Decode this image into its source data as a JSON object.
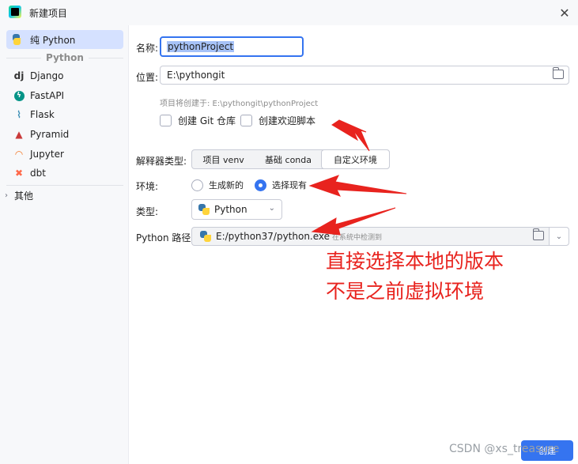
{
  "window": {
    "title": "新建项目"
  },
  "sidebar": {
    "items": [
      {
        "label": "纯 Python",
        "icon": "python-icon"
      },
      {
        "label": "Django",
        "icon": "django-icon"
      },
      {
        "label": "FastAPI",
        "icon": "fastapi-icon"
      },
      {
        "label": "Flask",
        "icon": "flask-icon"
      },
      {
        "label": "Pyramid",
        "icon": "pyramid-icon"
      },
      {
        "label": "Jupyter",
        "icon": "jupyter-icon"
      },
      {
        "label": "dbt",
        "icon": "dbt-icon"
      }
    ],
    "group_label": "Python",
    "other_label": "其他"
  },
  "form": {
    "name_label": "名称:",
    "name_value": "pythonProject",
    "location_label": "位置:",
    "location_value": "E:\\pythongit",
    "location_hint": "项目将创建于: E:\\pythongit\\pythonProject",
    "git_checkbox": "创建 Git 仓库",
    "welcome_checkbox": "创建欢迎脚本",
    "interpreter_label": "解释器类型:",
    "interpreter_tabs": [
      "项目 venv",
      "基础 conda",
      "自定义环境"
    ],
    "env_label": "环境:",
    "env_option_new": "生成新的",
    "env_option_existing": "选择现有",
    "type_label": "类型:",
    "type_value": "Python",
    "path_label": "Python 路径:",
    "path_value": "E:/python37/python.exe",
    "path_detected": "在系统中检测到",
    "create_button": "创建"
  },
  "annotation": {
    "line1": "直接选择本地的版本",
    "line2": "不是之前虚拟环境",
    "color": "#e8231e"
  },
  "watermark": "CSDN @xs_treasure",
  "colors": {
    "accent": "#3574f0",
    "sidebar_selected": "#d5e1ff"
  }
}
